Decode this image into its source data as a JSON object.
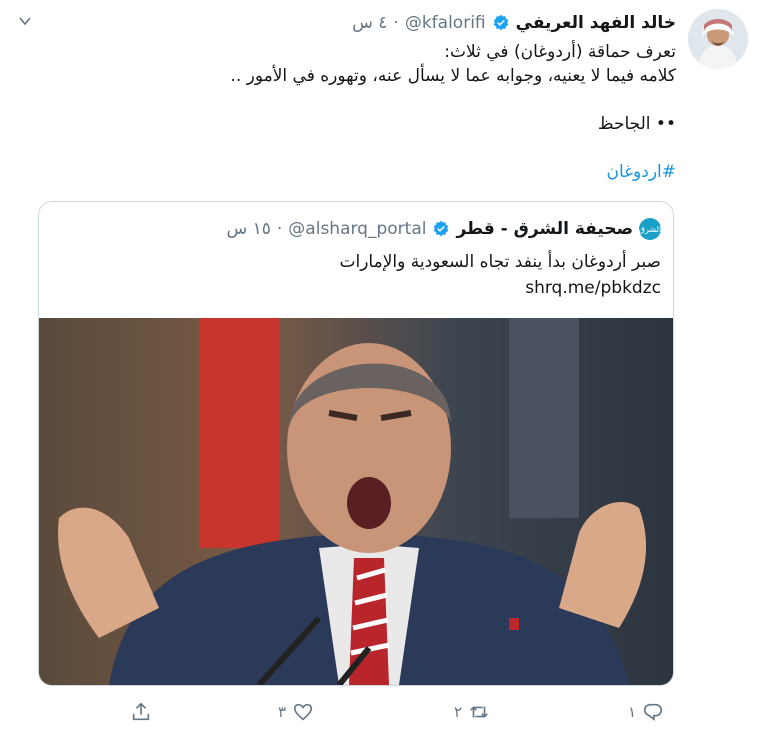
{
  "author": {
    "name": "خالد الفهد العريفي",
    "handle": "@kfalorifi",
    "separator": "·",
    "time": "٤ س"
  },
  "tweet": {
    "line1": "تعرف حماقة (أردوغان) في ثلاث:",
    "line2": "كلامه فيما لا يعنيه، وجوابه عما لا يسأل عنه، وتهوره في الأمور ..",
    "signature": "•• الجاحظ",
    "hashtag": "#اردوغان"
  },
  "quote": {
    "avatar_label": "الشرق",
    "name": "صحيفة الشرق - قطر",
    "handle": "@alsharq_portal",
    "separator": "·",
    "time": "١٥ س",
    "text": "صبر أردوغان بدأ ينفد تجاه السعودية والإمارات",
    "link": "shrq.me/pbkdzc"
  },
  "actions": {
    "reply_count": "١",
    "retweet_count": "٢",
    "like_count": "٣"
  },
  "colors": {
    "accent": "#1b95e0",
    "verified": "#1da1f2",
    "muted": "#657786",
    "border": "#ccd6dd"
  },
  "icons": [
    "chevron-down-icon",
    "verified-icon",
    "reply-icon",
    "retweet-icon",
    "like-icon",
    "share-icon"
  ]
}
